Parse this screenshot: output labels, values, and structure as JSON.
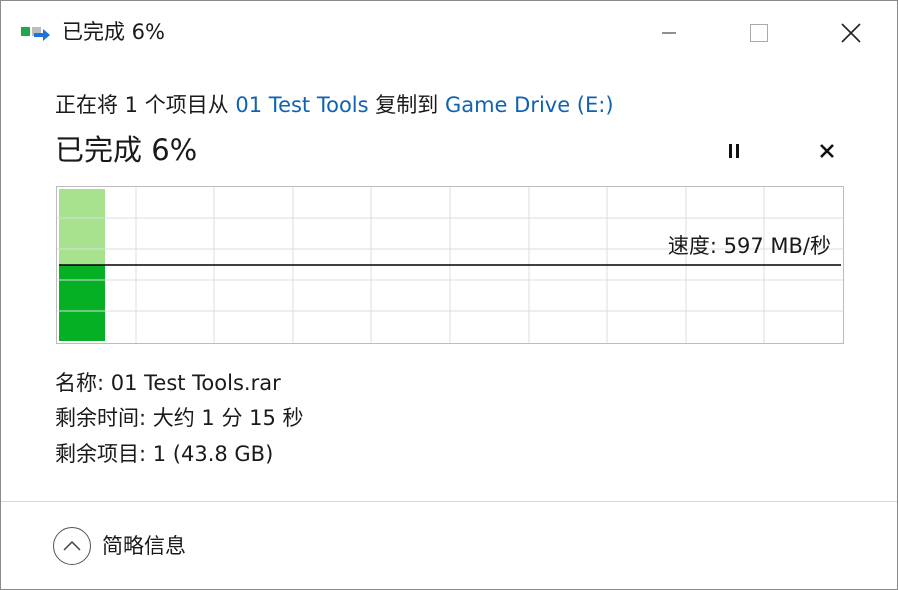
{
  "window": {
    "title": "已完成 6%",
    "icons": {
      "app": "copy-file-icon",
      "minimize": "minimize-icon",
      "maximize": "maximize-icon",
      "close": "close-icon"
    }
  },
  "main": {
    "copy_prefix": "正在将 1 个项目从",
    "source": "01 Test Tools",
    "copy_middle": "复制到",
    "destination": "Game Drive (E:)",
    "progress_heading": "已完成 6%",
    "progress_fraction": 0.06,
    "pause_icon": "pause-icon",
    "cancel_icon": "cancel-icon"
  },
  "graph": {
    "speed_label": "速度: 597 MB/秒",
    "colors": {
      "filled": "#06b025",
      "filled_light": "#a9e28f",
      "grid": "#d7dfe2",
      "speed_line": "#000000"
    }
  },
  "details": {
    "name": "名称: 01 Test Tools.rar",
    "time_remaining": "剩余时间: 大约 1 分 15 秒",
    "items_remaining": "剩余项目: 1 (43.8 GB)"
  },
  "footer": {
    "toggle_icon": "chevron-up-icon",
    "label": "简略信息"
  }
}
